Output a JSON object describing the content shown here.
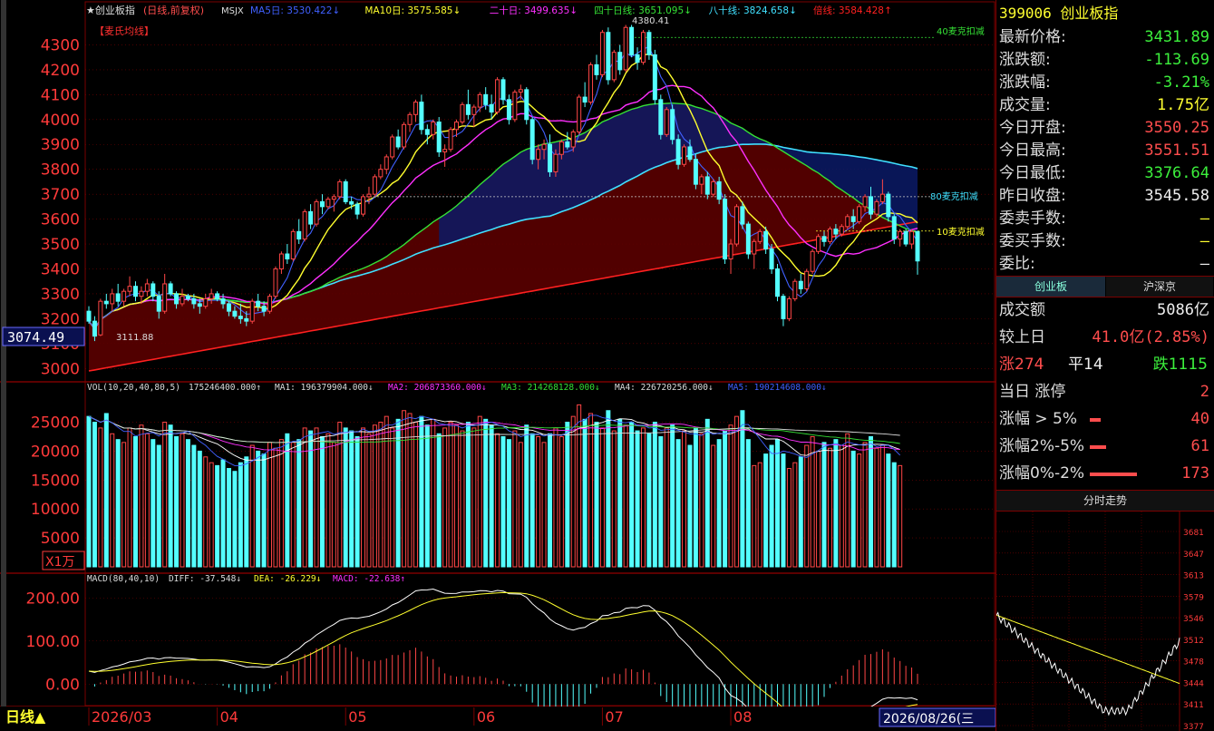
{
  "colors": {
    "up": "#ff4646",
    "down": "#54ffff",
    "ma5": "#ffffff",
    "ma10": "#ffff2e",
    "ma20": "#ff30ff",
    "ma40": "#35e035",
    "ma80": "#40e0ff",
    "ma250": "#ff2020",
    "grid": "#7a0000",
    "axis": "#ff3a3a"
  },
  "header": {
    "name": "★创业板指",
    "mode": "(日线,前复权)",
    "code": "MSJX",
    "items": [
      {
        "label": "MA5日:",
        "value": "3530.422↓",
        "color": "#4060ff"
      },
      {
        "label": "MA10日:",
        "value": "3575.585↓",
        "color": "#ffff2e"
      },
      {
        "label": "二十日:",
        "value": "3499.635↓",
        "color": "#ff30ff"
      },
      {
        "label": "四十日线:",
        "value": "3651.095↓",
        "color": "#35e035"
      },
      {
        "label": "八十线:",
        "value": "3824.658↓",
        "color": "#40e0ff"
      },
      {
        "label": "倍线:",
        "value": "3584.428↑",
        "color": "#ff2020"
      }
    ]
  },
  "indicator_name": "【麦氏均线】",
  "price_labels": {
    "high": "4380.41",
    "low": "3111.88",
    "current": "3074.49",
    "kou40": "40麦克扣减",
    "kou80": "80麦克扣减",
    "kou10": "10麦克扣减"
  },
  "vol_header": {
    "name": "VOL(10,20,40,80,5)",
    "value": "175246400.000↑",
    "ma1": "MA1: 196379904.000↓",
    "ma2": "MA2: 206873360.000↓",
    "ma3": "MA3: 214268128.000↓",
    "ma4": "MA4: 226720256.000↓",
    "ma5": "MA5: 190214608.000↓"
  },
  "vol_unit": "X1万",
  "macd_header": {
    "name": "MACD(80,40,10)",
    "diff": "DIFF: -37.548↓",
    "dea": "DEA: -26.229↓",
    "macd": "MACD: -22.638↑"
  },
  "bottom_bar": {
    "period": "日线▲",
    "months": [
      "2026/03",
      "04",
      "05",
      "06",
      "07",
      "08"
    ],
    "cursor_date": "2026/08/26(三"
  },
  "chart_data": [
    {
      "type": "candlestick",
      "id": "price",
      "ylim": [
        2950,
        4400
      ],
      "yticks": [
        3000,
        3100,
        3200,
        3300,
        3400,
        3500,
        3600,
        3700,
        3800,
        3900,
        4000,
        4100,
        4200,
        4300
      ],
      "candles": [
        [
          3230,
          3250,
          3180,
          3190
        ],
        [
          3190,
          3210,
          3110,
          3130
        ],
        [
          3135,
          3280,
          3130,
          3270
        ],
        [
          3270,
          3300,
          3240,
          3260
        ],
        [
          3260,
          3320,
          3230,
          3300
        ],
        [
          3300,
          3340,
          3250,
          3270
        ],
        [
          3270,
          3320,
          3250,
          3310
        ],
        [
          3310,
          3370,
          3290,
          3330
        ],
        [
          3330,
          3350,
          3270,
          3290
        ],
        [
          3290,
          3330,
          3260,
          3310
        ],
        [
          3310,
          3360,
          3290,
          3340
        ],
        [
          3340,
          3350,
          3270,
          3290
        ],
        [
          3290,
          3310,
          3200,
          3230
        ],
        [
          3230,
          3380,
          3220,
          3340
        ],
        [
          3340,
          3350,
          3290,
          3300
        ],
        [
          3300,
          3310,
          3240,
          3260
        ],
        [
          3260,
          3320,
          3250,
          3290
        ],
        [
          3290,
          3300,
          3270,
          3280
        ],
        [
          3280,
          3300,
          3240,
          3260
        ],
        [
          3260,
          3280,
          3220,
          3250
        ],
        [
          3250,
          3300,
          3240,
          3280
        ],
        [
          3280,
          3320,
          3260,
          3300
        ],
        [
          3300,
          3310,
          3270,
          3280
        ],
        [
          3280,
          3300,
          3240,
          3260
        ],
        [
          3260,
          3270,
          3210,
          3230
        ],
        [
          3230,
          3250,
          3200,
          3210
        ],
        [
          3210,
          3260,
          3180,
          3200
        ],
        [
          3200,
          3230,
          3170,
          3190
        ],
        [
          3190,
          3280,
          3180,
          3270
        ],
        [
          3270,
          3300,
          3230,
          3250
        ],
        [
          3250,
          3270,
          3210,
          3230
        ],
        [
          3230,
          3300,
          3220,
          3290
        ],
        [
          3290,
          3410,
          3280,
          3400
        ],
        [
          3400,
          3470,
          3380,
          3460
        ],
        [
          3460,
          3500,
          3420,
          3440
        ],
        [
          3440,
          3560,
          3430,
          3550
        ],
        [
          3550,
          3600,
          3500,
          3520
        ],
        [
          3520,
          3640,
          3510,
          3630
        ],
        [
          3630,
          3660,
          3560,
          3580
        ],
        [
          3580,
          3680,
          3570,
          3670
        ],
        [
          3670,
          3700,
          3620,
          3650
        ],
        [
          3650,
          3690,
          3640,
          3680
        ],
        [
          3680,
          3700,
          3630,
          3690
        ],
        [
          3690,
          3760,
          3680,
          3750
        ],
        [
          3750,
          3760,
          3660,
          3670
        ],
        [
          3670,
          3690,
          3640,
          3660
        ],
        [
          3660,
          3670,
          3600,
          3620
        ],
        [
          3620,
          3700,
          3610,
          3690
        ],
        [
          3690,
          3730,
          3660,
          3700
        ],
        [
          3700,
          3780,
          3690,
          3770
        ],
        [
          3770,
          3820,
          3760,
          3800
        ],
        [
          3800,
          3860,
          3780,
          3850
        ],
        [
          3850,
          3940,
          3840,
          3930
        ],
        [
          3930,
          3960,
          3880,
          3890
        ],
        [
          3890,
          3990,
          3880,
          3980
        ],
        [
          3980,
          4030,
          3950,
          4020
        ],
        [
          4020,
          4080,
          3990,
          4070
        ],
        [
          4070,
          4100,
          3940,
          3960
        ],
        [
          3960,
          3980,
          3900,
          3940
        ],
        [
          3940,
          4000,
          3920,
          3990
        ],
        [
          3990,
          4010,
          3850,
          3870
        ],
        [
          3870,
          3900,
          3810,
          3880
        ],
        [
          3880,
          3970,
          3870,
          3960
        ],
        [
          3960,
          4000,
          3930,
          3990
        ],
        [
          3990,
          4070,
          3980,
          4060
        ],
        [
          4060,
          4120,
          4000,
          4020
        ],
        [
          4020,
          4060,
          3970,
          4050
        ],
        [
          4050,
          4110,
          4030,
          4100
        ],
        [
          4100,
          4130,
          4040,
          4060
        ],
        [
          4060,
          4100,
          4000,
          4030
        ],
        [
          4030,
          4170,
          4020,
          4160
        ],
        [
          4160,
          4170,
          4060,
          4080
        ],
        [
          4080,
          4100,
          3980,
          4000
        ],
        [
          4000,
          4120,
          3990,
          4110
        ],
        [
          4110,
          4140,
          4080,
          4120
        ],
        [
          4120,
          4130,
          3980,
          4000
        ],
        [
          4000,
          4010,
          3820,
          3840
        ],
        [
          3840,
          3900,
          3800,
          3880
        ],
        [
          3880,
          3920,
          3840,
          3900
        ],
        [
          3900,
          3940,
          3770,
          3790
        ],
        [
          3790,
          3880,
          3770,
          3860
        ],
        [
          3860,
          3920,
          3840,
          3910
        ],
        [
          3910,
          3950,
          3880,
          3890
        ],
        [
          3890,
          3960,
          3870,
          3950
        ],
        [
          3950,
          4100,
          3940,
          4090
        ],
        [
          4090,
          4150,
          4050,
          4070
        ],
        [
          4070,
          4230,
          4060,
          4220
        ],
        [
          4220,
          4260,
          4160,
          4180
        ],
        [
          4180,
          4360,
          4170,
          4350
        ],
        [
          4350,
          4370,
          4140,
          4160
        ],
        [
          4160,
          4280,
          4150,
          4270
        ],
        [
          4270,
          4300,
          4180,
          4200
        ],
        [
          4200,
          4380,
          4190,
          4370
        ],
        [
          4370,
          4380,
          4250,
          4260
        ],
        [
          4260,
          4290,
          4200,
          4230
        ],
        [
          4230,
          4360,
          4220,
          4350
        ],
        [
          4350,
          4360,
          4240,
          4260
        ],
        [
          4260,
          4280,
          4060,
          4080
        ],
        [
          4080,
          4100,
          3920,
          3940
        ],
        [
          3940,
          4050,
          3930,
          4040
        ],
        [
          4040,
          4060,
          3900,
          3920
        ],
        [
          3920,
          3940,
          3800,
          3820
        ],
        [
          3820,
          3900,
          3810,
          3890
        ],
        [
          3890,
          3920,
          3830,
          3840
        ],
        [
          3840,
          3860,
          3720,
          3740
        ],
        [
          3740,
          3780,
          3700,
          3770
        ],
        [
          3770,
          3790,
          3680,
          3700
        ],
        [
          3700,
          3760,
          3690,
          3750
        ],
        [
          3750,
          3770,
          3660,
          3680
        ],
        [
          3680,
          3700,
          3420,
          3440
        ],
        [
          3440,
          3520,
          3380,
          3500
        ],
        [
          3500,
          3660,
          3490,
          3650
        ],
        [
          3650,
          3670,
          3560,
          3580
        ],
        [
          3580,
          3590,
          3440,
          3460
        ],
        [
          3460,
          3520,
          3400,
          3510
        ],
        [
          3510,
          3560,
          3500,
          3550
        ],
        [
          3550,
          3570,
          3460,
          3480
        ],
        [
          3480,
          3500,
          3380,
          3400
        ],
        [
          3400,
          3420,
          3270,
          3290
        ],
        [
          3290,
          3300,
          3170,
          3200
        ],
        [
          3200,
          3290,
          3190,
          3280
        ],
        [
          3280,
          3360,
          3270,
          3350
        ],
        [
          3350,
          3380,
          3300,
          3320
        ],
        [
          3320,
          3400,
          3310,
          3390
        ],
        [
          3390,
          3480,
          3380,
          3470
        ],
        [
          3470,
          3540,
          3460,
          3530
        ],
        [
          3530,
          3550,
          3490,
          3510
        ],
        [
          3510,
          3570,
          3500,
          3560
        ],
        [
          3560,
          3580,
          3520,
          3540
        ],
        [
          3540,
          3580,
          3530,
          3570
        ],
        [
          3570,
          3620,
          3560,
          3610
        ],
        [
          3610,
          3640,
          3560,
          3590
        ],
        [
          3590,
          3660,
          3580,
          3650
        ],
        [
          3650,
          3700,
          3630,
          3690
        ],
        [
          3690,
          3730,
          3600,
          3620
        ],
        [
          3620,
          3680,
          3610,
          3670
        ],
        [
          3670,
          3760,
          3660,
          3700
        ],
        [
          3700,
          3710,
          3590,
          3610
        ],
        [
          3610,
          3620,
          3500,
          3520
        ],
        [
          3520,
          3560,
          3490,
          3550
        ],
        [
          3550,
          3560,
          3490,
          3500
        ],
        [
          3500,
          3560,
          3480,
          3550
        ],
        [
          3550,
          3551.51,
          3376.64,
          3431.89
        ]
      ]
    },
    {
      "type": "bar",
      "id": "volume",
      "ylim": [
        0,
        29000
      ],
      "yticks": [
        5000,
        10000,
        15000,
        20000,
        25000
      ],
      "values": [
        26000,
        25000,
        24000,
        26500,
        23000,
        22000,
        21500,
        24000,
        22500,
        24500,
        23000,
        22000,
        21000,
        25000,
        24500,
        22500,
        23000,
        22000,
        21000,
        20000,
        19000,
        18000,
        17500,
        18500,
        17000,
        16500,
        18000,
        19000,
        21000,
        20000,
        19500,
        21500,
        20500,
        22000,
        23000,
        21500,
        22000,
        24000,
        23500,
        24000,
        22500,
        23000,
        21500,
        25000,
        24000,
        23500,
        22500,
        24000,
        23000,
        24500,
        25000,
        26000,
        24000,
        25500,
        27000,
        26500,
        25000,
        26000,
        24500,
        25500,
        23000,
        24000,
        25000,
        24500,
        23500,
        25000,
        24000,
        26000,
        25500,
        24500,
        23000,
        22500,
        22000,
        23500,
        21500,
        24500,
        23000,
        22500,
        21500,
        23000,
        24000,
        22500,
        25000,
        26000,
        28000,
        25500,
        26500,
        25000,
        24000,
        27000,
        23500,
        25500,
        24500,
        25000,
        23500,
        24000,
        23000,
        25000,
        22500,
        24000,
        24500,
        22000,
        23500,
        21000,
        24000,
        23000,
        25500,
        21000,
        22000,
        23500,
        24500,
        26000,
        27000,
        22000,
        17500,
        18000,
        19500,
        21000,
        22000,
        19500,
        17000,
        18000,
        19000,
        21000,
        22500,
        20000,
        21500,
        20500,
        22000,
        21000,
        23000,
        20000,
        19500,
        21500,
        22500,
        20500,
        21000,
        19500,
        18000,
        17500
      ],
      "ma_values": {
        "ma1": "196379904.000",
        "ma2": "206873360.000",
        "ma3": "214268128.000",
        "ma4": "226720256.000",
        "ma5": "190214608.000"
      }
    },
    {
      "type": "line",
      "id": "macd",
      "ylim": [
        -50,
        230
      ],
      "yticks": [
        0,
        100,
        200
      ],
      "tick_labels": [
        "0.00",
        "100.00",
        "200.00"
      ],
      "series": [
        {
          "name": "DIFF",
          "value": -37.548
        },
        {
          "name": "DEA",
          "value": -26.229
        },
        {
          "name": "MACD",
          "value": -22.638
        }
      ]
    }
  ],
  "sidebar": {
    "title": "399006 创业板指",
    "quote": [
      {
        "label": "最新价格:",
        "value": "3431.89",
        "color": "green"
      },
      {
        "label": "涨跌额:",
        "value": "-113.69",
        "color": "green"
      },
      {
        "label": "涨跌幅:",
        "value": "-3.21%",
        "color": "green"
      },
      {
        "label": "成交量:",
        "value": "1.75亿",
        "color": "yellow"
      },
      {
        "label": "今日开盘:",
        "value": "3550.25",
        "color": "red"
      },
      {
        "label": "今日最高:",
        "value": "3551.51",
        "color": "red"
      },
      {
        "label": "今日最低:",
        "value": "3376.64",
        "color": "green"
      },
      {
        "label": "昨日收盘:",
        "value": "3545.58",
        "color": "white"
      },
      {
        "label": "委卖手数:",
        "value": "—",
        "color": "yellow"
      },
      {
        "label": "委买手数:",
        "value": "—",
        "color": "yellow"
      },
      {
        "label": "委比:",
        "value": "—",
        "color": "white"
      }
    ],
    "tabs": [
      "创业板",
      "沪深京"
    ],
    "stats": {
      "turnover_label": "成交额",
      "turnover_value": "5086亿",
      "prev_label": "较上日",
      "prev_value": "41.0亿(2.85%)",
      "up": "涨274",
      "flat": "平14",
      "down": "跌1115",
      "limit_label": "当日 涨停",
      "limit_value": "2",
      "r1_label": "涨幅 > 5%",
      "r1_value": "40",
      "r1_fill": 0.23,
      "r2_label": "涨幅2%-5%",
      "r2_value": "61",
      "r2_fill": 0.35,
      "r3_label": "涨幅0%-2%",
      "r3_value": "173",
      "r3_fill": 1.0
    },
    "intraday_title": "分时走势",
    "intraday_ticks": [
      "3681",
      "3647",
      "3613",
      "3579",
      "3546",
      "3512",
      "3478",
      "3444",
      "3411",
      "3377"
    ]
  }
}
